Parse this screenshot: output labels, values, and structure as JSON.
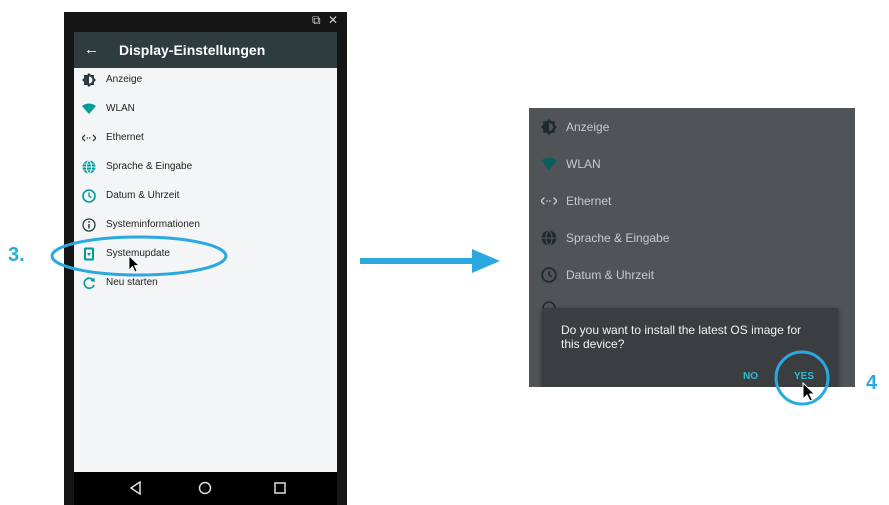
{
  "device": {
    "app_title": "Display-Einstellungen",
    "menu": [
      {
        "label": "Anzeige",
        "icon": "brightness-icon"
      },
      {
        "label": "WLAN",
        "icon": "wifi-icon"
      },
      {
        "label": "Ethernet",
        "icon": "ethernet-icon"
      },
      {
        "label": "Sprache & Eingabe",
        "icon": "globe-icon"
      },
      {
        "label": "Datum & Uhrzeit",
        "icon": "clock-icon"
      },
      {
        "label": "Systeminformationen",
        "icon": "info-icon"
      },
      {
        "label": "Systemupdate",
        "icon": "system-update-icon"
      },
      {
        "label": "Neu starten",
        "icon": "restart-icon"
      }
    ]
  },
  "annotations": {
    "step3": "3.",
    "step4": "4"
  },
  "zoom": {
    "menu": [
      {
        "label": "Anzeige",
        "icon": "brightness-icon"
      },
      {
        "label": "WLAN",
        "icon": "wifi-icon"
      },
      {
        "label": "Ethernet",
        "icon": "ethernet-icon"
      },
      {
        "label": "Sprache & Eingabe",
        "icon": "globe-icon"
      },
      {
        "label": "Datum & Uhrzeit",
        "icon": "clock-icon"
      }
    ],
    "dialog": {
      "message": "Do you want to install the latest OS image for this device?",
      "no_label": "NO",
      "yes_label": "YES"
    }
  },
  "colors": {
    "accent": "#2aa8e0",
    "appbar": "#2e3b3f",
    "dialog_button": "#2bbcd0"
  }
}
